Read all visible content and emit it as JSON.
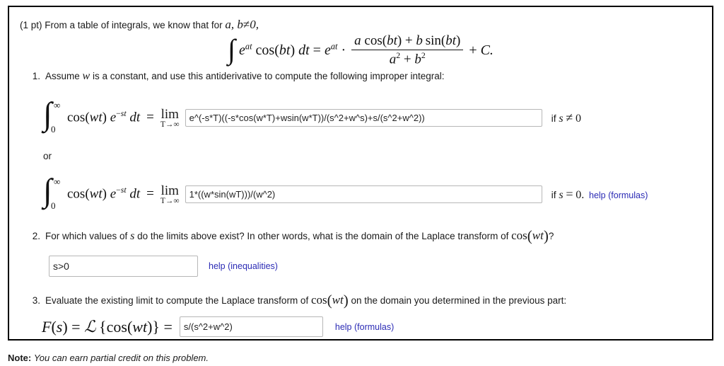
{
  "problem": {
    "points_label": "(1 pt)",
    "intro_text_before": "From a table of integrals, we know that for",
    "intro_vars": "a, b",
    "intro_neq": "≠",
    "intro_zero": "0,",
    "display_formula": {
      "integral_symbol": "∫",
      "integrand": "e^{at} cos(bt) dt",
      "equals": "=",
      "factor": "e^{at}",
      "dot": "·",
      "fraction_numerator": "a cos(bt) + b sin(bt)",
      "fraction_denominator": "a² + b²",
      "plus_c": "+ C."
    }
  },
  "items": [
    {
      "number": "1.",
      "text_before": "Assume",
      "variable": "w",
      "text_after": "is a constant, and use this antiderivative to compute the following improper integral:"
    },
    {
      "number": "2.",
      "text_before": "For which values of",
      "variable": "s",
      "text_mid": "do the limits above exist? In other words, what is the domain of the Laplace transform of",
      "function": "cos(wt)",
      "text_after": "?"
    },
    {
      "number": "3.",
      "text_before": "Evaluate the existing limit to compute the Laplace transform of",
      "function": "cos(wt)",
      "text_after": "on the domain you determined in the previous part:"
    }
  ],
  "integral_rows": [
    {
      "lower_limit": "0",
      "upper_limit": "∞",
      "integrand": "cos(wt) e^{-st} dt",
      "equals": "=",
      "limit_label": "lim",
      "limit_sub": "T→∞",
      "answer_value": "e^(-s*T)((-s*cos(w*T)+wsin(w*T))/(s^2+w^s)+s/(s^2+w^2))",
      "condition_if": "if",
      "condition_var": "s",
      "condition_symbol": "≠",
      "condition_value": "0",
      "help_label": ""
    },
    {
      "lower_limit": "0",
      "upper_limit": "∞",
      "integrand": "cos(wt) e^{-st} dt",
      "equals": "=",
      "limit_label": "lim",
      "limit_sub": "T→∞",
      "answer_value": "1*((w*sin(wT)))/(w^2)",
      "condition_if": "if",
      "condition_var": "s",
      "condition_symbol": "=",
      "condition_value": "0.",
      "help_label": "help (formulas)"
    }
  ],
  "or_label": "or",
  "domain_answer": {
    "value": "s>0",
    "help_label": "help (inequalities)"
  },
  "laplace_answer": {
    "lhs_f": "F(s)",
    "lhs_equals": "=",
    "script_l": "ℒ",
    "lhs_braces_open": "{",
    "lhs_function": "cos(wt)",
    "lhs_braces_close": "}",
    "lhs_equals2": "=",
    "value": "s/(s^2+w^2)",
    "help_label": "help (formulas)"
  },
  "note": {
    "label": "Note:",
    "text": "You can earn partial credit on this problem."
  },
  "colors": {
    "link": "#2b2bb5",
    "frame_border": "#000000",
    "input_border": "#b7b7b7",
    "text": "#1a1a1a"
  }
}
